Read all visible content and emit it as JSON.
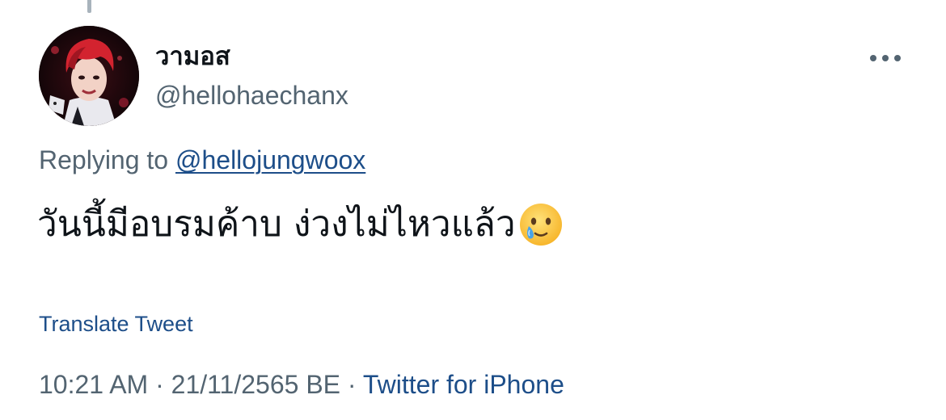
{
  "tweet": {
    "author": {
      "display_name": "วามอส",
      "handle": "@hellohaechanx"
    },
    "reply": {
      "prefix": "Replying to ",
      "to_handle": "@hellojungwoox"
    },
    "text": "วันนี้มีอบรมค้าบ ง่วงไม่ไหวแล้ว",
    "emoji": "face-holding-back-tears-icon",
    "translate_label": "Translate Tweet",
    "time": "10:21 AM",
    "separator": " · ",
    "date": "21/11/2565 BE",
    "source": "Twitter for iPhone"
  },
  "colors": {
    "text_primary": "#0f1419",
    "text_secondary": "#536471",
    "link": "#1d4e89"
  }
}
